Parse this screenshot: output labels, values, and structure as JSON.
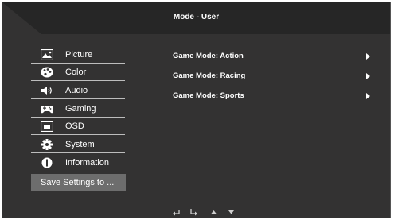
{
  "header": {
    "title": "Mode - User"
  },
  "menu": {
    "items": [
      {
        "label": "Picture",
        "icon": "picture-icon"
      },
      {
        "label": "Color",
        "icon": "palette-icon"
      },
      {
        "label": "Audio",
        "icon": "speaker-icon"
      },
      {
        "label": "Gaming",
        "icon": "gamepad-icon"
      },
      {
        "label": "OSD",
        "icon": "osd-icon"
      },
      {
        "label": "System",
        "icon": "gear-icon"
      },
      {
        "label": "Information",
        "icon": "info-icon"
      }
    ],
    "save_label": "Save Settings to ..."
  },
  "game_modes": [
    {
      "label": "Game Mode: Action"
    },
    {
      "label": "Game Mode: Racing"
    },
    {
      "label": "Game Mode: Sports"
    }
  ],
  "nav": {
    "icons": [
      "return-icon",
      "enter-icon",
      "up-arrow-icon",
      "down-arrow-icon"
    ]
  },
  "colors": {
    "panel": "#333232",
    "header": "#262626",
    "highlight": "#6d6d6d",
    "text": "#ffffff"
  }
}
